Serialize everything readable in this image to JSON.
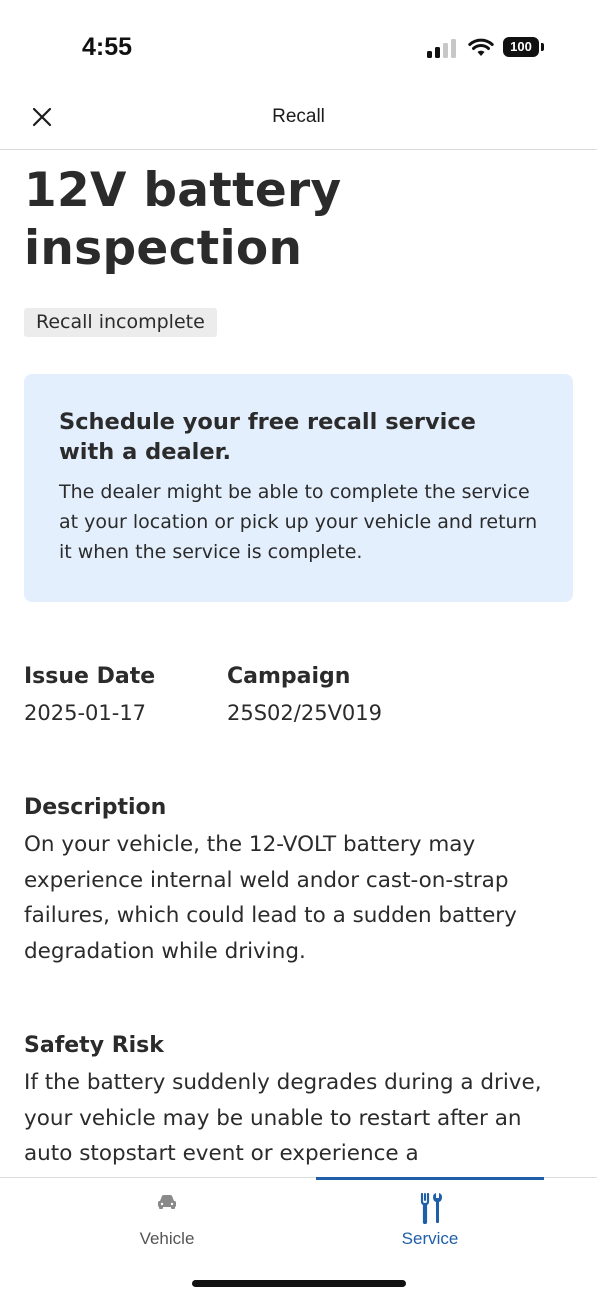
{
  "status_bar": {
    "time": "4:55",
    "battery_level": "100",
    "icons": [
      "cellular-signal-icon",
      "wifi-icon",
      "battery-icon"
    ]
  },
  "header": {
    "title": "Recall",
    "close_icon": "close-icon"
  },
  "recall": {
    "title": "12V battery inspection",
    "status": "Recall incomplete",
    "info_card": {
      "heading": "Schedule your free recall service with a dealer.",
      "body": "The dealer might be able to complete the service at your location or pick up your vehicle and return it when the service is complete."
    },
    "issue_date_label": "Issue Date",
    "issue_date": "2025-01-17",
    "campaign_label": "Campaign",
    "campaign": "25S02/25V019",
    "description_label": "Description",
    "description": "On your vehicle, the 12-VOLT battery may experience internal weld andor cast-on-strap failures, which could lead to a sudden battery degradation while driving.",
    "safety_risk_label": "Safety Risk",
    "safety_risk": "If the battery suddenly degrades during a drive, your vehicle may be unable to restart after an auto stopstart event or experience a"
  },
  "tab_bar": {
    "tabs": [
      {
        "label": "Vehicle",
        "icon": "car-icon",
        "selected": false
      },
      {
        "label": "Service",
        "icon": "tools-icon",
        "selected": true
      }
    ]
  },
  "colors": {
    "accent": "#1f5fa8",
    "info_card_bg": "#e3effd",
    "badge_bg": "#ececec",
    "text": "#2b2b2b"
  }
}
